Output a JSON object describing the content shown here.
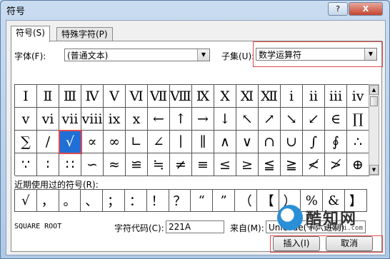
{
  "window": {
    "title": "符号",
    "help_label": "?",
    "close_label": "X"
  },
  "tabs": [
    {
      "label": "符号(S)",
      "active": true
    },
    {
      "label": "特殊字符(P)",
      "active": false
    }
  ],
  "font": {
    "label": "字体(F):",
    "value": "(普通文本)"
  },
  "subset": {
    "label": "子集(U):",
    "value": "数学运算符"
  },
  "symbols": [
    "Ⅰ",
    "Ⅱ",
    "Ⅲ",
    "Ⅳ",
    "Ⅴ",
    "Ⅵ",
    "Ⅶ",
    "Ⅷ",
    "Ⅸ",
    "Ⅹ",
    "Ⅺ",
    "Ⅻ",
    "ⅰ",
    "ⅱ",
    "ⅲ",
    "ⅳ",
    "ⅴ",
    "ⅵ",
    "ⅶ",
    "ⅷ",
    "ⅸ",
    "ⅹ",
    "←",
    "↑",
    "→",
    "↓",
    "↖",
    "↗",
    "↘",
    "↙",
    "∈",
    "∏",
    "∑",
    "∕",
    "√",
    "∝",
    "∞",
    "∟",
    "∠",
    "∣",
    "∥",
    "∧",
    "∨",
    "∩",
    "∪",
    "∫",
    "∮",
    "∴",
    "∵",
    "∶",
    "∷",
    "∽",
    "≈",
    "≌",
    "≒",
    "≠",
    "≡",
    "≤",
    "≥",
    "≦",
    "≧",
    "≮",
    "≯",
    "⊕"
  ],
  "selected_index": 34,
  "recent": {
    "label": "近期使用过的符号(R):",
    "items": [
      "√",
      "，",
      "。",
      "、",
      "；",
      "：",
      "！",
      "？",
      "“",
      "”",
      "（",
      "【",
      "）",
      "%",
      "&",
      "】"
    ]
  },
  "char_name": "SQUARE ROOT",
  "char_code": {
    "label": "字符代码(C):",
    "value": "221A"
  },
  "from": {
    "label": "来自(M):",
    "value": "Unicode(十六进制)"
  },
  "buttons": {
    "insert": "插入(I)",
    "cancel": "取消"
  },
  "watermark": {
    "text": "酷知网",
    "url": "www.coozhi.com"
  }
}
